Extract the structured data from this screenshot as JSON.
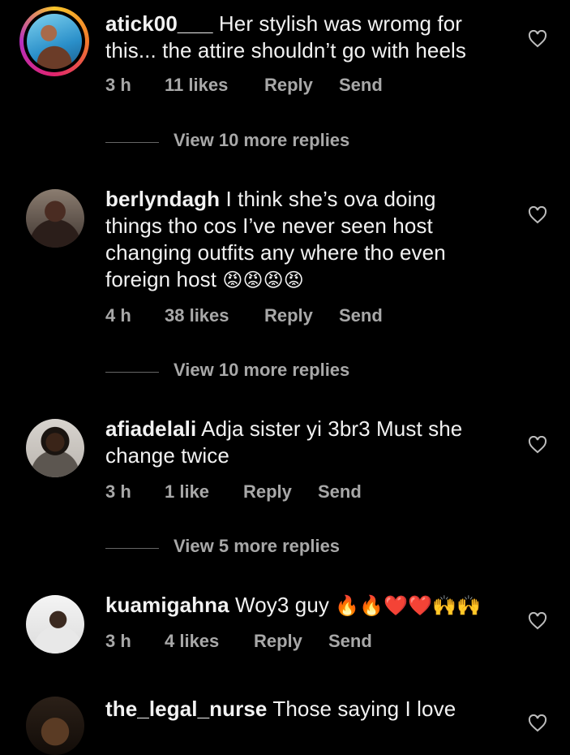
{
  "comments": [
    {
      "username": "atick00___",
      "text": "Her stylish was wromg for this... the attire shouldn’t go with heels",
      "emoji": "",
      "time": "3 h",
      "likes": "11 likes",
      "reply": "Reply",
      "send": "Send",
      "view_replies": "View 10 more replies"
    },
    {
      "username": "berlyndagh",
      "text": "I think she’s ova doing things tho cos I’ve never seen host changing outfits any where tho even foreign host",
      "emoji": "😡😡😡😡",
      "time": "4 h",
      "likes": "38 likes",
      "reply": "Reply",
      "send": "Send",
      "view_replies": "View 10 more replies"
    },
    {
      "username": "afiadelali",
      "text": "Adja sister yi 3br3  Must she change twice",
      "emoji": "",
      "time": "3 h",
      "likes": "1 like",
      "reply": "Reply",
      "send": "Send",
      "view_replies": "View 5 more replies"
    },
    {
      "username": "kuamigahna",
      "text": "Woy3 guy",
      "emoji": "🔥🔥❤️❤️🙌🙌",
      "time": "3 h",
      "likes": "4 likes",
      "reply": "Reply",
      "send": "Send"
    },
    {
      "username": "the_legal_nurse",
      "text": "Those saying I love"
    }
  ],
  "icons": {
    "like": "heart-outline-icon"
  },
  "colors": {
    "background": "#000000",
    "text": "#f2f2f2",
    "meta": "#a8a8a8"
  }
}
